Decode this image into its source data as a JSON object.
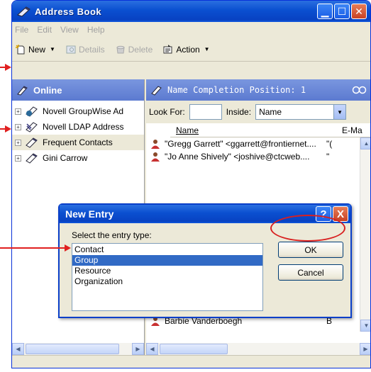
{
  "window": {
    "title": "Address Book"
  },
  "menu": [
    "File",
    "Edit",
    "View",
    "Help"
  ],
  "toolbar": {
    "new": "New",
    "details": "Details",
    "delete": "Delete",
    "action": "Action"
  },
  "left_pane": {
    "title": "Online",
    "items": [
      {
        "label": "Novell GroupWise Ad"
      },
      {
        "label": "Novell LDAP Address"
      },
      {
        "label": "Frequent Contacts"
      },
      {
        "label": "Gini Carrow"
      }
    ]
  },
  "right_pane": {
    "title": "Name Completion Position: 1",
    "look_for_label": "Look For:",
    "inside_label": "Inside:",
    "inside_value": "Name",
    "columns": [
      "Name",
      "E-Ma"
    ],
    "rows": [
      {
        "name": "\"Gregg Garrett\" <ggarrett@frontiernet....",
        "email": "\"("
      },
      {
        "name": "\"Jo Anne Shively\" <joshive@ctcweb....",
        "email": "\""
      },
      {
        "name": "Barbie Vanderboegh",
        "email": "B"
      }
    ]
  },
  "dialog": {
    "title": "New Entry",
    "prompt": "Select the entry type:",
    "types": [
      "Contact",
      "Group",
      "Resource",
      "Organization"
    ],
    "selected": "Group",
    "ok": "OK",
    "cancel": "Cancel",
    "help_glyph": "?",
    "close_glyph": "X"
  },
  "colors": {
    "annotation": "#e02020",
    "xp_blue": "#0a4fd0",
    "selection": "#316ac5"
  }
}
